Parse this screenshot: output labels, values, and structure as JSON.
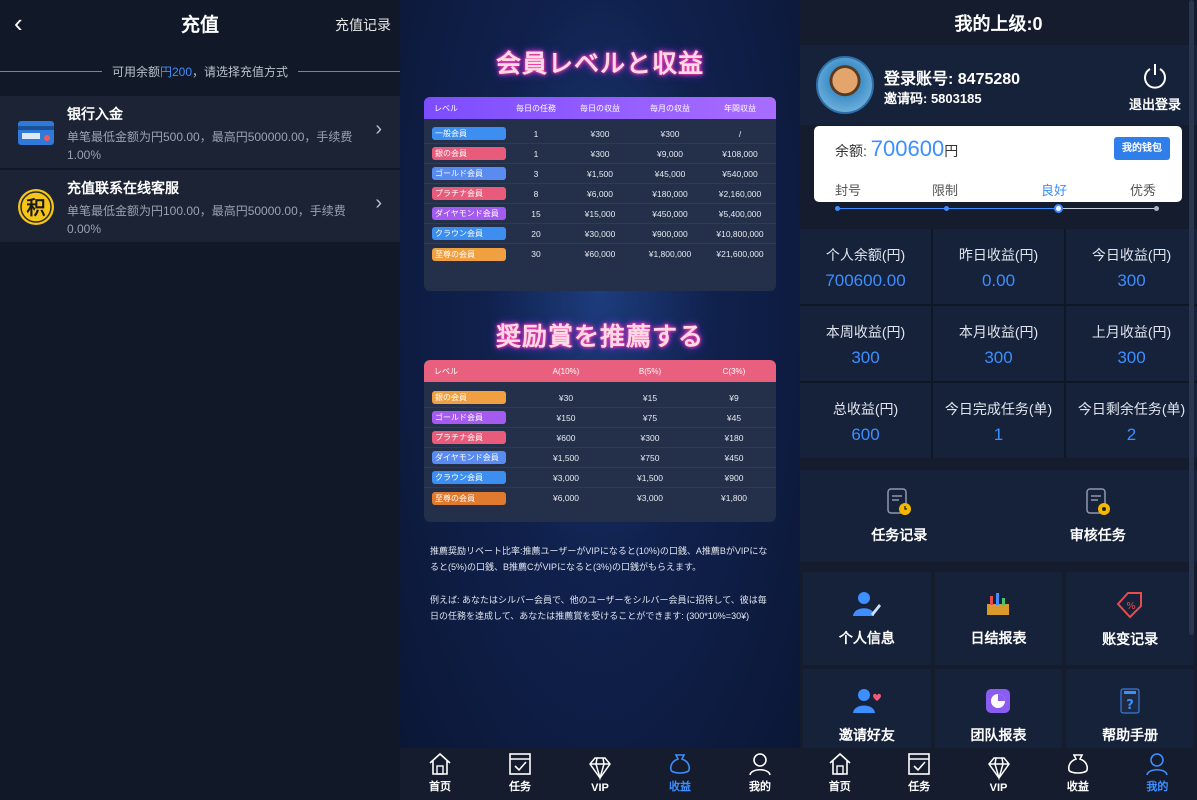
{
  "recharge": {
    "title": "充值",
    "records_label": "充值记录",
    "balance_prefix": "可用余额",
    "balance_amount": "円200",
    "balance_suffix": "，请选择充值方式",
    "methods": [
      {
        "name": "银行入金",
        "desc": "单笔最低金额为円500.00，最高円500000.00，手续费 1.00%",
        "icon": "bank-card-icon"
      },
      {
        "name": "充值联系在线客服",
        "desc": "单笔最低金额为円100.00，最高円50000.00，手续费 0.00%",
        "icon": "points-icon"
      }
    ],
    "points_glyph": "积"
  },
  "benefits": {
    "title1": "会員レベルと収益",
    "table1": {
      "headers": [
        "レベル",
        "毎日の任務",
        "毎日の収益",
        "毎月の収益",
        "年間収益"
      ],
      "rows": [
        {
          "level": "一般会員",
          "color": "#3c8ff0",
          "c": [
            "1",
            "¥300",
            "¥300",
            "/"
          ]
        },
        {
          "level": "銀の会員",
          "color": "#e95b7b",
          "c": [
            "1",
            "¥300",
            "¥9,000",
            "¥108,000"
          ]
        },
        {
          "level": "ゴールド会員",
          "color": "#5a8bf0",
          "c": [
            "3",
            "¥1,500",
            "¥45,000",
            "¥540,000"
          ]
        },
        {
          "level": "プラチナ会員",
          "color": "#e95b7b",
          "c": [
            "8",
            "¥6,000",
            "¥180,000",
            "¥2,160,000"
          ]
        },
        {
          "level": "ダイヤモンド会員",
          "color": "#a35bf0",
          "c": [
            "15",
            "¥15,000",
            "¥450,000",
            "¥5,400,000"
          ]
        },
        {
          "level": "クラウン会員",
          "color": "#3c8ff0",
          "c": [
            "20",
            "¥30,000",
            "¥900,000",
            "¥10,800,000"
          ]
        },
        {
          "level": "至尊の会員",
          "color": "#f0a040",
          "c": [
            "30",
            "¥60,000",
            "¥1,800,000",
            "¥21,600,000"
          ]
        }
      ]
    },
    "title2": "奨励賞を推薦する",
    "table2": {
      "headers": [
        "レベル",
        "A(10%)",
        "B(5%)",
        "C(3%)"
      ],
      "rows": [
        {
          "level": "銀の会員",
          "color": "#f0a040",
          "c": [
            "¥30",
            "¥15",
            "¥9"
          ]
        },
        {
          "level": "ゴールド会員",
          "color": "#a35bf0",
          "c": [
            "¥150",
            "¥75",
            "¥45"
          ]
        },
        {
          "level": "プラチナ会員",
          "color": "#e95b7b",
          "c": [
            "¥600",
            "¥300",
            "¥180"
          ]
        },
        {
          "level": "ダイヤモンド会員",
          "color": "#5a8bf0",
          "c": [
            "¥1,500",
            "¥750",
            "¥450"
          ]
        },
        {
          "level": "クラウン会員",
          "color": "#3c8ff0",
          "c": [
            "¥3,000",
            "¥1,500",
            "¥900"
          ]
        },
        {
          "level": "至尊の会員",
          "color": "#e07a2e",
          "c": [
            "¥6,000",
            "¥3,000",
            "¥1,800"
          ]
        }
      ]
    },
    "note1": "推薦奨励リベート比率:推薦ユーザーがVIPになると(10%)の口銭、A推薦BがVIPになると(5%)の口銭、B推薦CがVIPになると(3%)の口銭がもらえます。",
    "note2": "例えば: あなたはシルバー会員で、他のユーザーをシルバー会員に招待して、彼は毎日の任務を達成して、あなたは推薦賞を受けることができます: (300*10%=30¥)"
  },
  "tabs": [
    "首页",
    "任务",
    "VIP",
    "收益",
    "我的"
  ],
  "profile": {
    "header": "我的上级:0",
    "account": "登录账号: 8475280",
    "invite": "邀请码: 5803185",
    "logout": "退出登录",
    "balance_label": "余额:",
    "balance_value": "700600",
    "balance_unit": "円",
    "wallet": "我的钱包",
    "levels": [
      "封号",
      "限制",
      "良好",
      "优秀"
    ],
    "stats": [
      {
        "label": "个人余额(円)",
        "value": "700600.00"
      },
      {
        "label": "昨日收益(円)",
        "value": "0.00"
      },
      {
        "label": "今日收益(円)",
        "value": "300"
      },
      {
        "label": "本周收益(円)",
        "value": "300"
      },
      {
        "label": "本月收益(円)",
        "value": "300"
      },
      {
        "label": "上月收益(円)",
        "value": "300"
      },
      {
        "label": "总收益(円)",
        "value": "600"
      },
      {
        "label": "今日完成任务(单)",
        "value": "1"
      },
      {
        "label": "今日剩余任务(单)",
        "value": "2"
      }
    ],
    "task_links": [
      "任务记录",
      "审核任务"
    ],
    "menu": [
      "个人信息",
      "日结报表",
      "账变记录",
      "邀请好友",
      "团队报表",
      "帮助手册"
    ]
  }
}
